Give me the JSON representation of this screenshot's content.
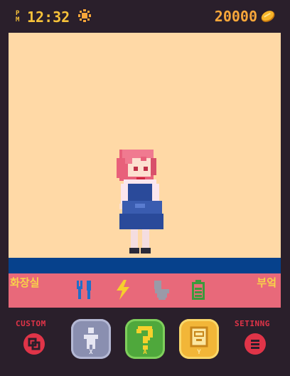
{
  "status": {
    "period": [
      "P",
      "M"
    ],
    "time": "12:32",
    "weather_icon": "sun-icon",
    "money": "20000",
    "currency_icon": "coin-icon"
  },
  "room": {
    "location": "화장실",
    "menu": "부엌"
  },
  "stats": [
    {
      "name": "hunger",
      "icon": "fork-knife-icon",
      "color": "#1f6fc9"
    },
    {
      "name": "energy",
      "icon": "lightning-icon",
      "color": "#f6cf2c"
    },
    {
      "name": "toilet",
      "icon": "toilet-icon",
      "color": "#9a9aa8"
    },
    {
      "name": "battery",
      "icon": "battery-icon",
      "color": "#3c9a3c"
    }
  ],
  "controls": {
    "custom_label": "CUSTOM",
    "setting_label": "SETINNG",
    "x_button": "X",
    "a_button": "A",
    "y_button": "Y"
  },
  "colors": {
    "stage": "#ffd9a6",
    "floor": "#06418c",
    "statusbar": "#e8697a",
    "accent_yellow": "#f7c23a",
    "accent_red": "#e03448"
  }
}
